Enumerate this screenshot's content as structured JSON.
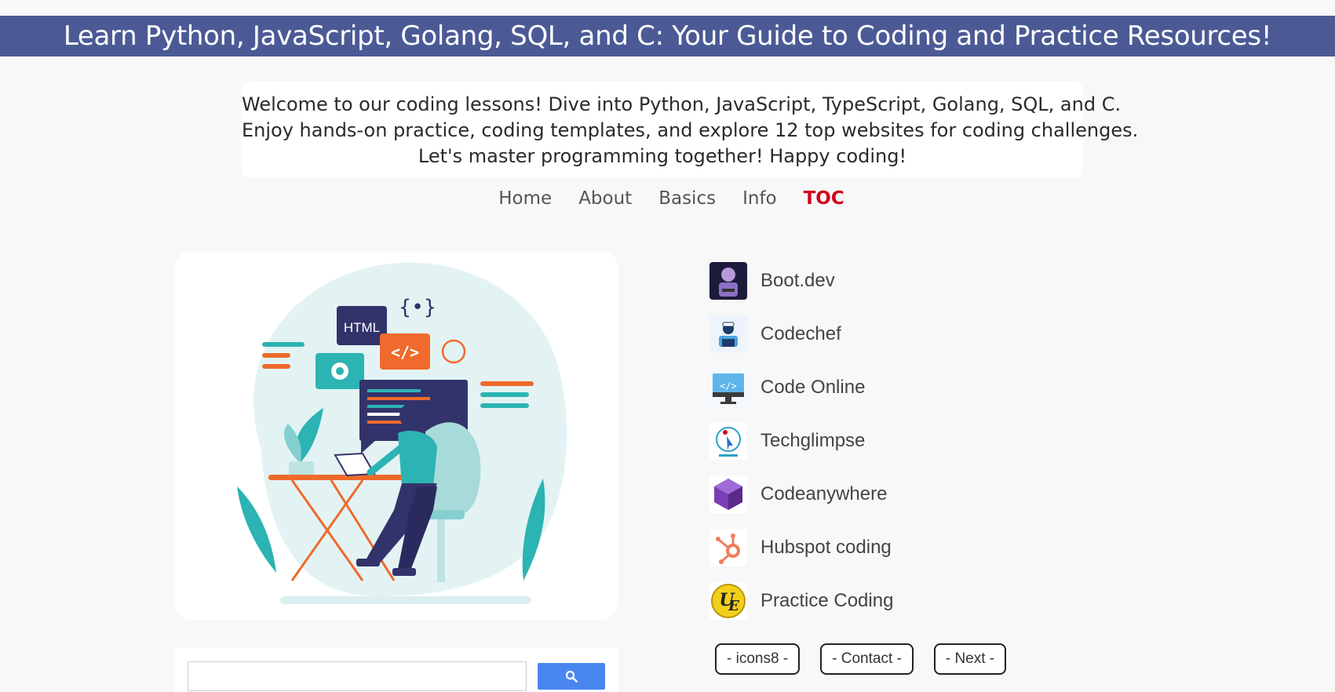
{
  "header": {
    "title": "Learn Python, JavaScript, Golang, SQL, and C: Your Guide to Coding and Practice Resources!",
    "background": "#4b5a95"
  },
  "intro": {
    "lines": [
      "Welcome to our coding lessons! Dive into Python, JavaScript, TypeScript, Golang, SQL, and C.",
      "Enjoy hands-on practice, coding templates, and explore 12 top websites for coding challenges.",
      "Let's master programming together! Happy coding!"
    ]
  },
  "nav": {
    "items": [
      {
        "label": "Home"
      },
      {
        "label": "About"
      },
      {
        "label": "Basics"
      },
      {
        "label": "Info"
      },
      {
        "label": "TOC",
        "active": true
      }
    ],
    "active_color": "#d0021b"
  },
  "illustration": {
    "html_tag": "HTML",
    "code_tag": "</>",
    "brace_tag": "{•}"
  },
  "search": {
    "placeholder": "",
    "button_icon": "search-icon",
    "button_color": "#4a86f0"
  },
  "sites": [
    {
      "label": "Boot.dev",
      "icon": "bootdev-icon"
    },
    {
      "label": "Codechef",
      "icon": "codechef-icon"
    },
    {
      "label": "Code Online",
      "icon": "code-online-icon"
    },
    {
      "label": "Techglimpse",
      "icon": "techglimpse-icon"
    },
    {
      "label": "Codeanywhere",
      "icon": "codeanywhere-icon"
    },
    {
      "label": "Hubspot coding",
      "icon": "hubspot-icon"
    },
    {
      "label": "Practice Coding",
      "icon": "practice-coding-icon"
    }
  ],
  "buttons": {
    "icons8": "- icons8 -",
    "contact": "- Contact -",
    "next": "- Next -"
  }
}
